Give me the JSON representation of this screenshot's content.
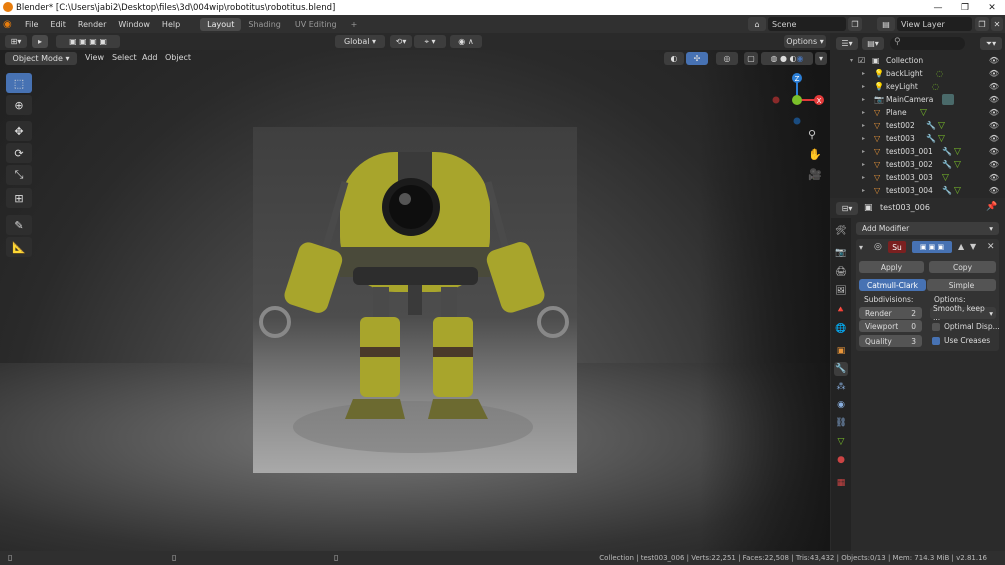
{
  "window": {
    "title": "Blender* [C:\\Users\\jabi2\\Desktop\\files\\3d\\004wip\\robotitus\\robotitus.blend]",
    "minimize": "—",
    "maximize": "❐",
    "close": "✕"
  },
  "menubar": {
    "items": [
      "File",
      "Edit",
      "Render",
      "Window",
      "Help"
    ],
    "workspaces": [
      "Layout",
      "Shading",
      "UV Editing"
    ],
    "add_workspace": "+",
    "scene": "Scene",
    "view_layer": "View Layer"
  },
  "viewport_header": {
    "transform_orientation": "Global",
    "options": "Options",
    "mode": "Object Mode",
    "menus": [
      "View",
      "Select",
      "Add",
      "Object"
    ]
  },
  "gizmo": {
    "z": "Z",
    "x": "X"
  },
  "outliner": {
    "collection": "Collection",
    "items": [
      "backLight",
      "keyLight",
      "MainCamera",
      "Plane",
      "test002",
      "test003",
      "test003_001",
      "test003_002",
      "test003_003",
      "test003_004"
    ]
  },
  "properties": {
    "object_name": "test003_006",
    "add_modifier": "Add Modifier",
    "modifier_short": "Su",
    "apply": "Apply",
    "copy": "Copy",
    "catmull_clark": "Catmull-Clark",
    "simple": "Simple",
    "subdivisions_label": "Subdivisions:",
    "options_label": "Options:",
    "render_label": "Render",
    "render_value": "2",
    "viewport_label": "Viewport",
    "viewport_value": "0",
    "quality_label": "Quality",
    "quality_value": "3",
    "uv_smooth": "Smooth, keep ...",
    "optimal_display": "Optimal Disp...",
    "use_creases": "Use Creases"
  },
  "statusbar": {
    "text": "Collection | test003_006 | Verts:22,251 | Faces:22,508 | Tris:43,432 | Objects:0/13 | Mem: 714.3 MiB | v2.81.16"
  },
  "colors": {
    "accent": "#4772b3",
    "object_orange": "#e8953a",
    "gizmo_x": "#e33a3a",
    "gizmo_y": "#7bc02a",
    "gizmo_z": "#2b7ed6",
    "robot_yellow": "#a8a52c"
  }
}
